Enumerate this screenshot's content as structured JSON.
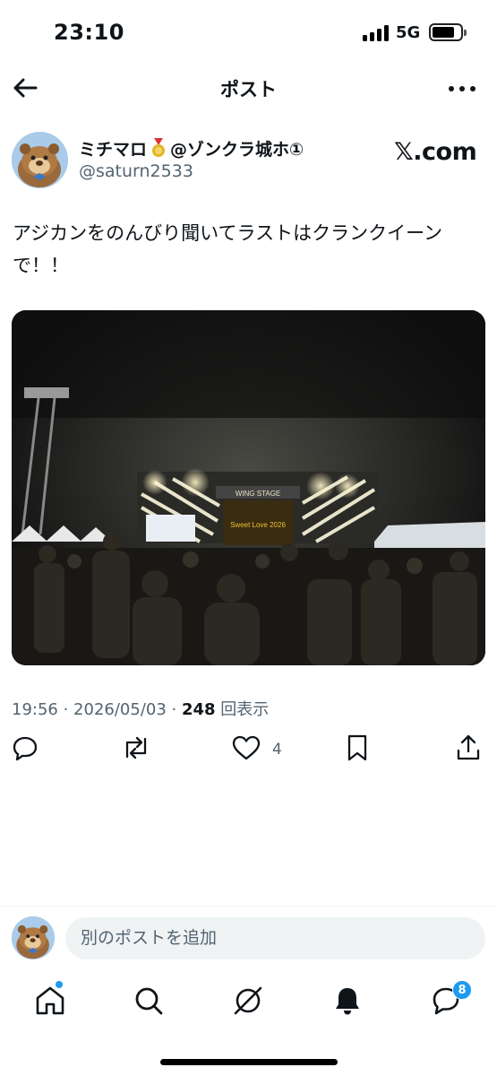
{
  "status_bar": {
    "time": "23:10",
    "network": "5G"
  },
  "header": {
    "title": "ポスト"
  },
  "post": {
    "author_name": "ミチマロ",
    "author_name_suffix": "@ゾンクラ城ホ①",
    "handle": "@saturn2533",
    "source_logo": "𝕏.com",
    "text_line1": "アジカンをのんびり聞いてラストはクランクイーン",
    "text_line2": "で！！",
    "photo_signage": {
      "stage": "WING STAGE",
      "screen": "Sweet Love 2026"
    },
    "time": "19:56",
    "date": "2026/05/03",
    "views": "248",
    "views_label": "回表示",
    "likes": "4"
  },
  "reply": {
    "placeholder": "別のポストを追加"
  },
  "tabbar": {
    "messages_badge": "8"
  },
  "colors": {
    "accent": "#1d9bf0",
    "text": "#0f1419",
    "secondary": "#536471",
    "input_bg": "#eff3f4"
  },
  "icons": [
    "back-arrow-icon",
    "more-icon",
    "medal-icon",
    "reply-icon",
    "repost-icon",
    "like-icon",
    "bookmark-icon",
    "share-icon",
    "home-icon",
    "search-icon",
    "grok-icon",
    "bell-icon",
    "messages-icon"
  ]
}
